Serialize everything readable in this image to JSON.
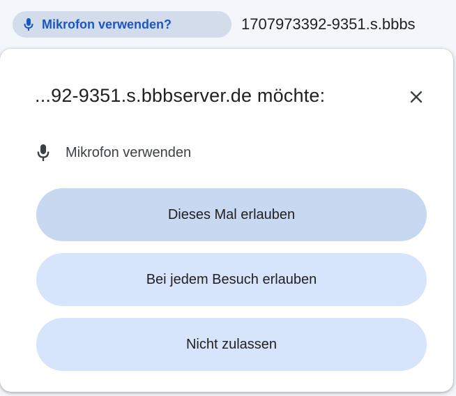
{
  "addressbar": {
    "chip_label": "Mikrofon verwenden?",
    "chip_icon": "microphone-icon",
    "url_text": "1707973392-9351.s.bbbs"
  },
  "popup": {
    "title": "...92-9351.s.bbbserver.de möchte:",
    "close_icon": "close-icon",
    "permission": {
      "icon": "microphone-icon",
      "label": "Mikrofon verwenden"
    },
    "buttons": {
      "allow_once": "Dieses Mal erlauben",
      "allow_always": "Bei jedem Besuch erlauben",
      "deny": "Nicht zulassen"
    }
  },
  "colors": {
    "accent": "#1a56c7",
    "chip_background": "#d3dcea",
    "button_primary": "#c8d8f0",
    "button_secondary": "#d7e5fc"
  }
}
